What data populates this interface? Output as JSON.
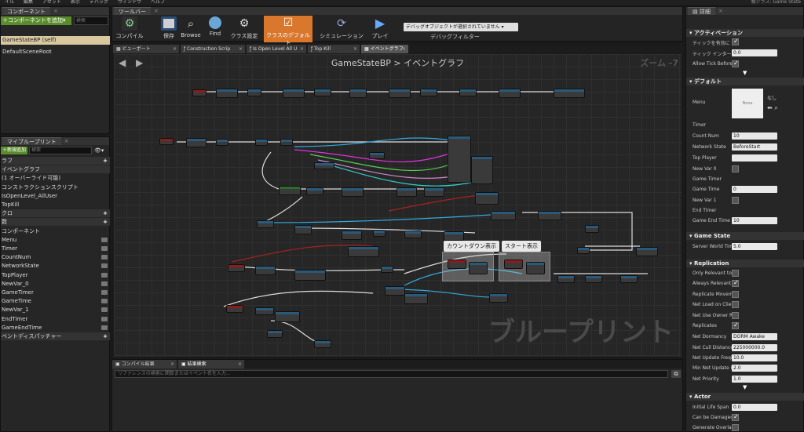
{
  "menubar": {
    "items": [
      "イル",
      "編集",
      "アセット",
      "表示",
      "デバッグ",
      "ウィンドウ",
      "ヘルプ"
    ],
    "right": "親クラス: Game State"
  },
  "components": {
    "tab": "コンポーネント",
    "add_button": "コンポーネントを追加",
    "search_placeholder": "検索",
    "self_item": "GameStateBP (self)",
    "root_item": "DefaultSceneRoot"
  },
  "myblueprint": {
    "tab": "マイブループリント",
    "add_new": "新規追加",
    "search_placeholder": "検索",
    "rows": [
      {
        "label": "ラフ",
        "section": true,
        "plus": true
      },
      {
        "label": "イベントグラフ",
        "section": true
      },
      {
        "label": "(1 オーバーライド可能)",
        "section": false
      },
      {
        "label": "コンストラクションスクリプト",
        "section": false
      },
      {
        "label": "IsOpenLevel_AllUser",
        "section": false
      },
      {
        "label": "TopKill",
        "section": false
      },
      {
        "label": "クロ",
        "section": true,
        "plus": true
      },
      {
        "label": "数",
        "section": true,
        "plus": true
      },
      {
        "label": "コンポーネント",
        "section": false
      },
      {
        "label": "Menu",
        "section": false,
        "var": true
      },
      {
        "label": "Timer",
        "section": false,
        "var": true
      },
      {
        "label": "CountNum",
        "section": false,
        "var": true
      },
      {
        "label": "NetworkState",
        "section": false,
        "var": true
      },
      {
        "label": "TopPlayer",
        "section": false,
        "var": true
      },
      {
        "label": "NewVar_0",
        "section": false,
        "var": true
      },
      {
        "label": "GameTimer",
        "section": false,
        "var": true
      },
      {
        "label": "GameTime",
        "section": false,
        "var": true
      },
      {
        "label": "NewVar_1",
        "section": false,
        "var": true
      },
      {
        "label": "EndTimer",
        "section": false,
        "var": true
      },
      {
        "label": "GameEndTime",
        "section": false,
        "var": true
      },
      {
        "label": "ベントディスパッチャー",
        "section": true,
        "plus": true
      }
    ]
  },
  "toolbar": {
    "tab": "ツールバー",
    "buttons": [
      "コンパイル",
      "保存",
      "Browse",
      "Find",
      "クラス設定",
      "クラスのデフォルト",
      "シミュレーション",
      "プレイ"
    ],
    "debug_select": "デバッグオブジェクトが選択されていません",
    "debug_label": "デバッグフィルター"
  },
  "graph_tabs": [
    "ビューポート",
    "Construction Scrip",
    "Is Open Level All U",
    "Top Kill",
    "イベントグラフ"
  ],
  "graph": {
    "title": "GameStateBP > イベントグラフ",
    "zoom": "ズーム -7",
    "watermark": "ブループリント",
    "comment1": "カウントダウン表示",
    "comment2": "スタート表示"
  },
  "bottom": {
    "tabs": [
      "コンパイル結果",
      "結果検索"
    ],
    "find_placeholder": "リファレンスの検索に関数またはイベント名を入力..."
  },
  "details": {
    "tab": "詳細",
    "sections": {
      "activation": "アクティベーション",
      "default": "デフォルト",
      "game_state": "Game State",
      "replication": "Replication",
      "actor": "Actor"
    },
    "rows": {
      "tick_enabled": "ティックを有効に",
      "tick_interval": "ティック インター",
      "tick_interval_val": "0.0",
      "allow_tick": "Allow Tick Before",
      "menu": "Menu",
      "menu_none": "None",
      "menu_value": "なし",
      "timer": "Timer",
      "count_num": "Count Num",
      "count_num_val": "10",
      "network_state": "Network State",
      "network_state_val": "BeforeStart",
      "top_player": "Top Player",
      "new_var0": "New Var 0",
      "game_timer": "Game Timer",
      "game_time": "Game Time",
      "game_time_val": "0",
      "new_var1": "New Var 1",
      "end_timer": "End Timer",
      "game_end_time": "Game End Time",
      "game_end_time_val": "10",
      "server_world": "Server World Tim",
      "server_world_val": "5.0",
      "only_relevant": "Only Relevant to",
      "always_relevant": "Always Relevant",
      "replicate_movement": "Replicate Movem",
      "net_load": "Net Load on Clier",
      "net_use_owner": "Net Use Owner R",
      "replicates": "Replicates",
      "net_dormancy": "Net Dormancy",
      "net_dormancy_val": "DORM Awake",
      "net_cull": "Net Cull Distance",
      "net_cull_val": "225000000.0",
      "net_update_freq": "Net Update Freqi",
      "net_update_freq_val": "10.0",
      "min_net_update": "Min Net Update F",
      "min_net_update_val": "2.0",
      "net_priority": "Net Priority",
      "net_priority_val": "1.0",
      "initial_life": "Initial Life Span",
      "initial_life_val": "0.0",
      "can_be_damaged": "Can be Damaged",
      "generate_overlap": "Generate Overlap"
    }
  }
}
